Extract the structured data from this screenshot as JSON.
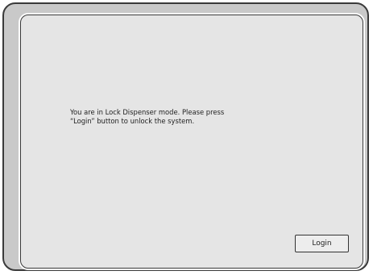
{
  "screen": {
    "message_line1": "You are in Lock Dispenser mode. Please press",
    "message_line2": "“Login” button to unlock the system.",
    "login_label": "Login"
  },
  "colors": {
    "frame_outer": "#c9c9c9",
    "screen_background": "#e5e5e5",
    "border": "#3a3a3a"
  }
}
